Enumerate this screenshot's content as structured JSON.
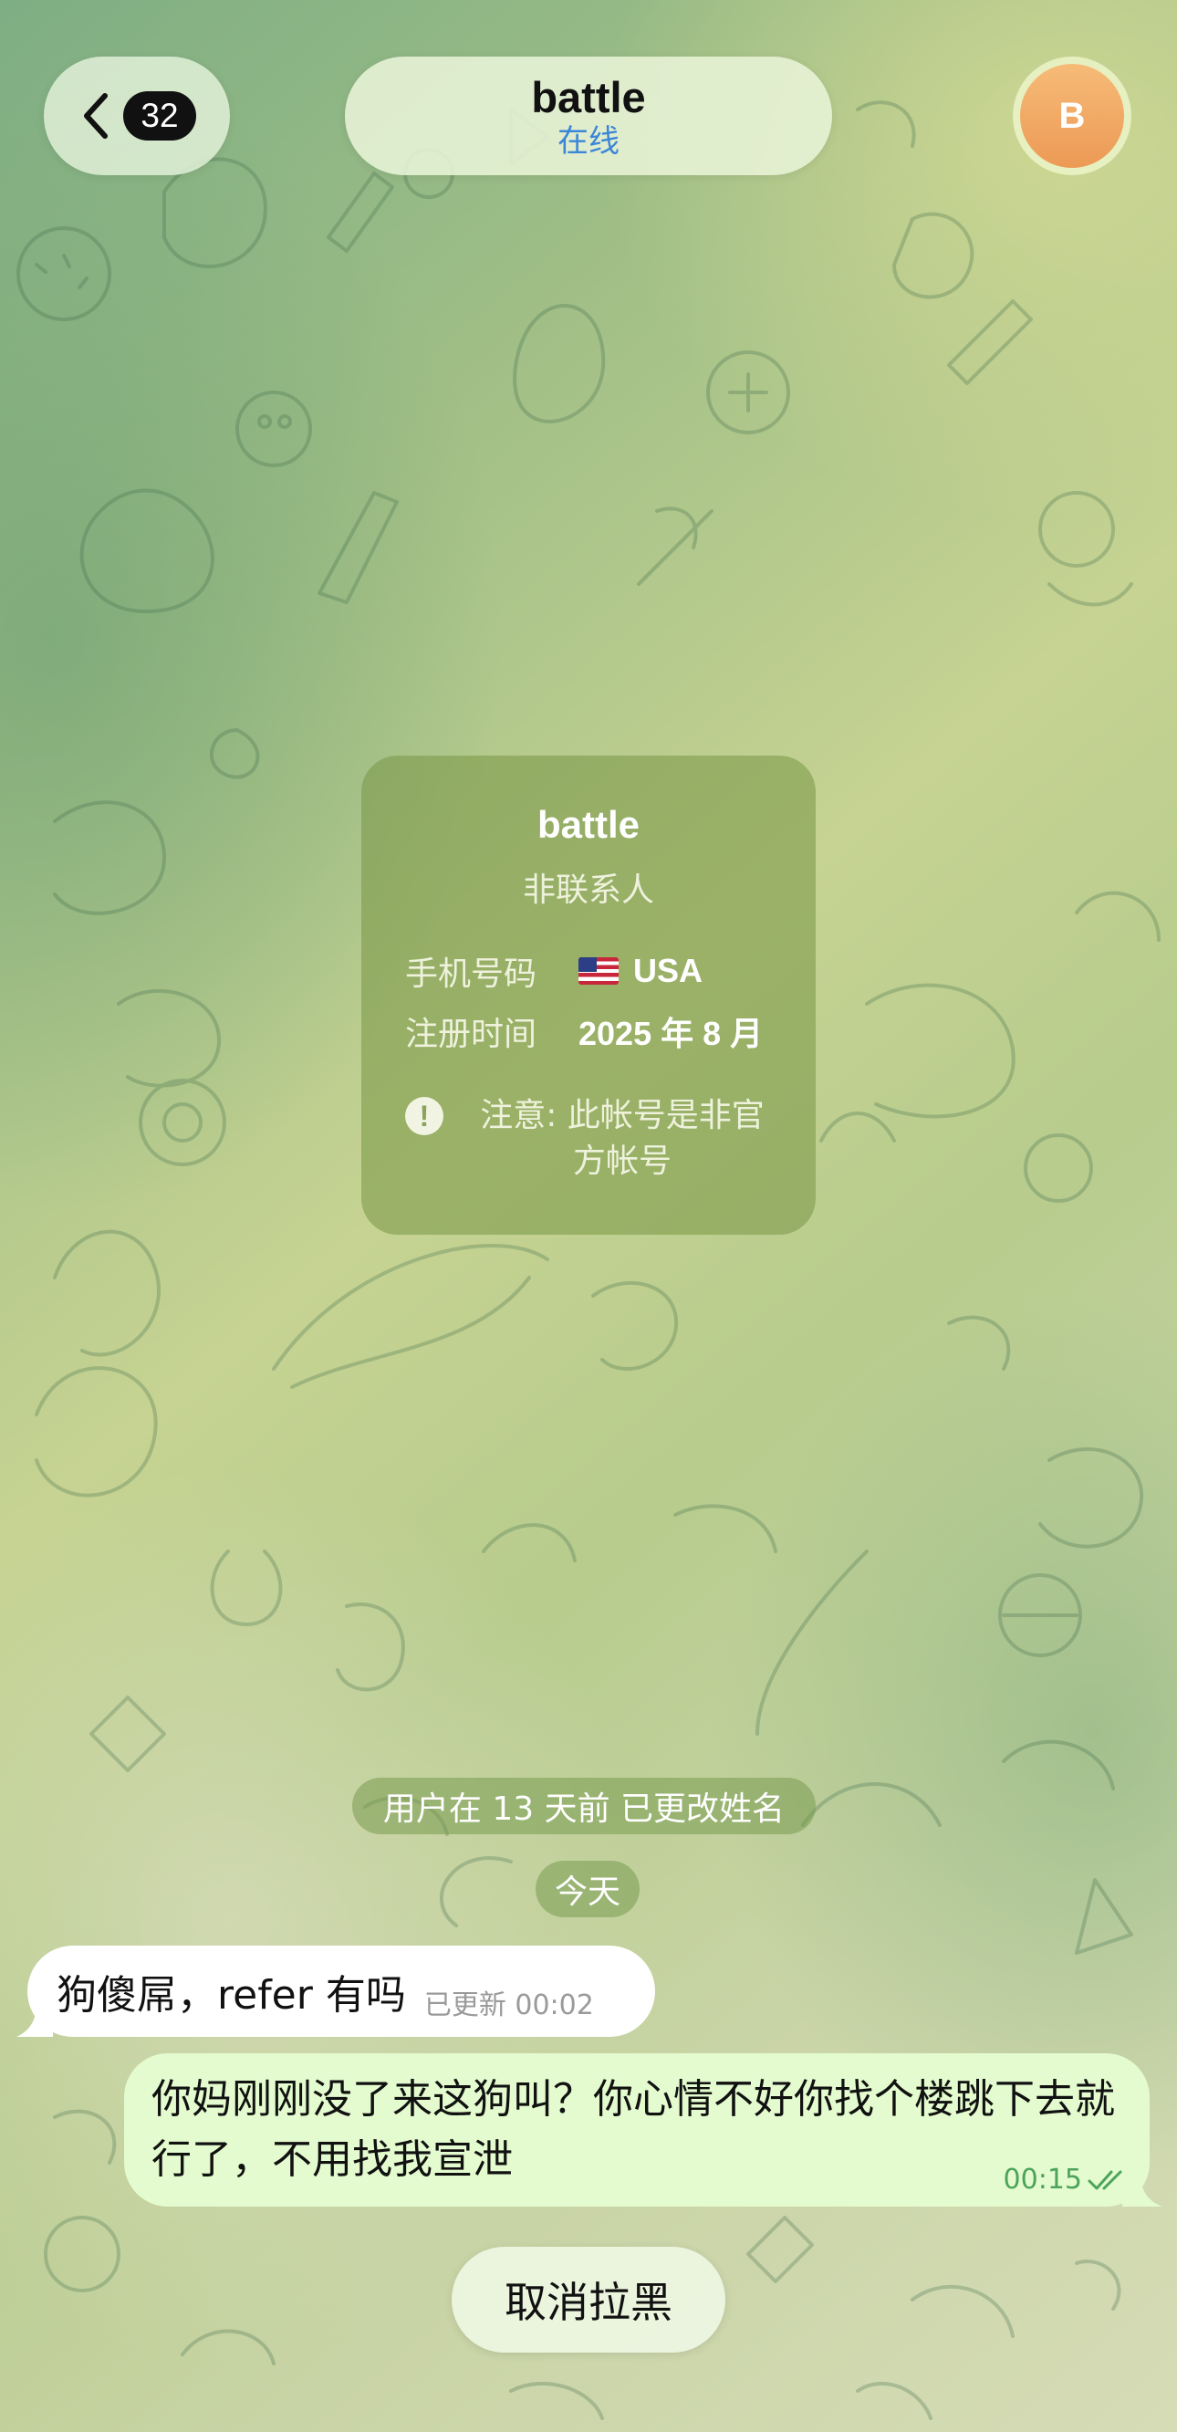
{
  "header": {
    "back_icon": "chevron-left-icon",
    "unread_count": "32",
    "chat_name": "battle",
    "status": "在线",
    "avatar_letter": "B"
  },
  "info_card": {
    "name": "battle",
    "subtitle": "非联系人",
    "phone_label": "手机号码",
    "phone_value": "USA",
    "phone_flag": "us-flag-icon",
    "registered_label": "注册时间",
    "registered_value": "2025 年 8 月",
    "warning_icon": "exclamation-circle-icon",
    "warning_text": "注意: 此帐号是非官方帐号"
  },
  "service": {
    "rename_notice": "用户在 13 天前 已更改姓名",
    "date_divider": "今天"
  },
  "messages": [
    {
      "direction": "incoming",
      "text": "狗傻屌，refer 有吗",
      "meta": "已更新 00:02"
    },
    {
      "direction": "outgoing",
      "text": "你妈刚刚没了来这狗叫？你心情不好你找个楼跳下去就行了，不用找我宣泄",
      "time": "00:15",
      "status_icon": "double-check-icon"
    }
  ],
  "actions": {
    "unblock_label": "取消拉黑"
  },
  "colors": {
    "status_blue": "#3b86d8",
    "outgoing_bubble": "#e3fbce",
    "read_check_green": "#4ca35a",
    "avatar_orange": "#f0a660"
  }
}
